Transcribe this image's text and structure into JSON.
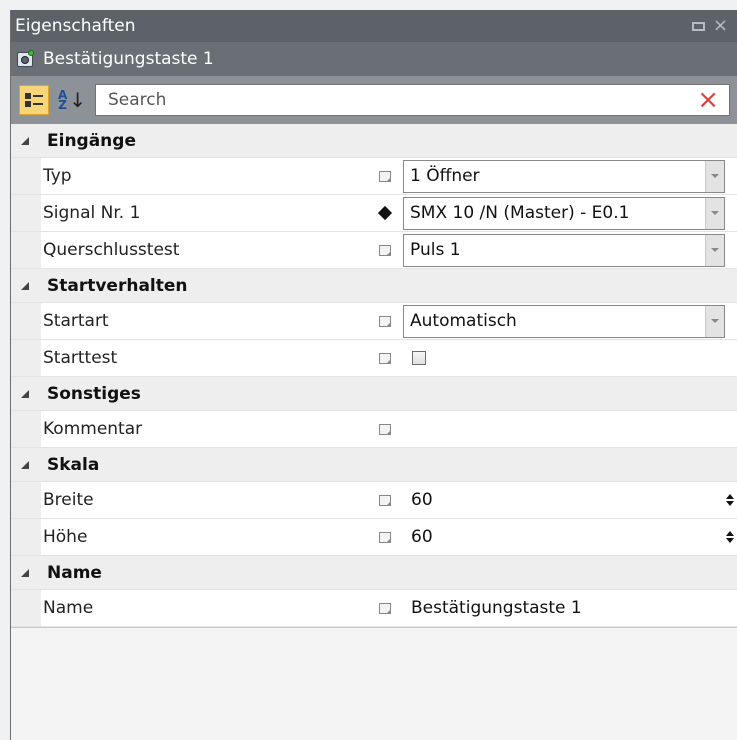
{
  "window": {
    "title": "Eigenschaften",
    "restore_icon": "restore-icon",
    "close_glyph": "×"
  },
  "object": {
    "title": "Bestätigungstaste 1",
    "icon": "acknowledge-button-icon"
  },
  "toolbar": {
    "categorized_icon": "categorized-view-icon",
    "sort_glyph_top": "A",
    "sort_glyph_bottom": "Z",
    "sort_arrow": "↓",
    "search_placeholder": "Search",
    "clear_glyph": "×"
  },
  "categories": [
    {
      "label": "Eingänge",
      "rows": [
        {
          "name": "Typ",
          "marker": "default",
          "type": "combo",
          "value": "1 Öffner"
        },
        {
          "name": "Signal Nr. 1",
          "marker": "diamond",
          "type": "combo",
          "value": "SMX 10 /N (Master) - E0.1"
        },
        {
          "name": "Querschlusstest",
          "marker": "default",
          "type": "combo",
          "value": "Puls 1"
        }
      ]
    },
    {
      "label": "Startverhalten",
      "rows": [
        {
          "name": "Startart",
          "marker": "default",
          "type": "combo",
          "value": "Automatisch"
        },
        {
          "name": "Starttest",
          "marker": "default",
          "type": "checkbox",
          "checked": false
        }
      ]
    },
    {
      "label": "Sonstiges",
      "rows": [
        {
          "name": "Kommentar",
          "marker": "default",
          "type": "text",
          "value": ""
        }
      ]
    },
    {
      "label": "Skala",
      "rows": [
        {
          "name": "Breite",
          "marker": "default",
          "type": "spinner",
          "value": "60"
        },
        {
          "name": "Höhe",
          "marker": "default",
          "type": "spinner",
          "value": "60"
        }
      ]
    },
    {
      "label": "Name",
      "rows": [
        {
          "name": "Name",
          "marker": "default",
          "type": "text",
          "value": "Bestätigungstaste 1"
        }
      ]
    }
  ]
}
